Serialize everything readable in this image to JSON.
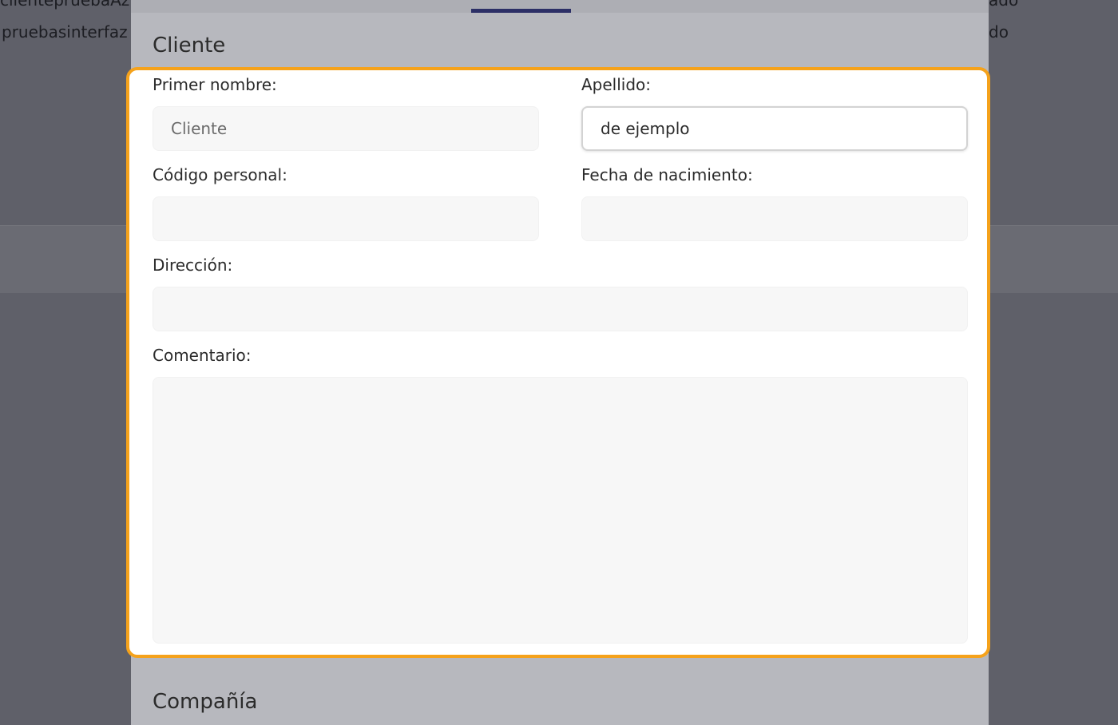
{
  "background": {
    "top_left_text": "clientepruebaAz",
    "left_text": "pruebasinterfaz",
    "top_right_text": "ado",
    "right_text": "do"
  },
  "modal": {
    "section_cliente": "Cliente",
    "section_compania": "Compañía",
    "fields": {
      "first_name": {
        "label": "Primer nombre:",
        "placeholder": "Cliente",
        "value": ""
      },
      "last_name": {
        "label": "Apellido:",
        "value": "de ejemplo"
      },
      "personal_code": {
        "label": "Código personal:",
        "value": ""
      },
      "birth_date": {
        "label": "Fecha de nacimiento:",
        "value": ""
      },
      "address": {
        "label": "Dirección:",
        "value": ""
      },
      "comment": {
        "label": "Comentario:",
        "value": ""
      }
    }
  },
  "colors": {
    "highlight": "#f5a21b",
    "tab_indicator": "#2c2f66",
    "overlay": "#5f6069"
  }
}
